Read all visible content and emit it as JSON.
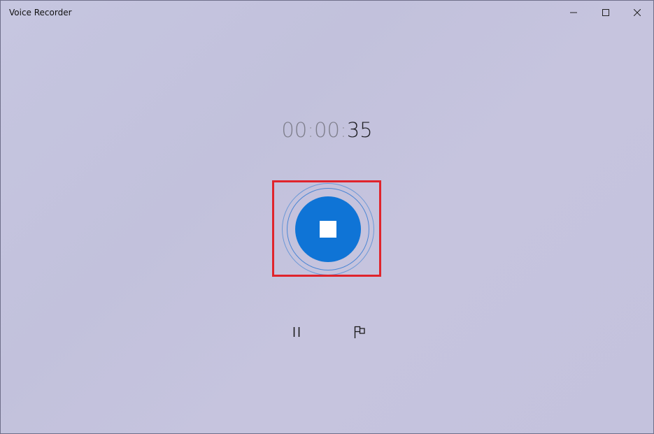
{
  "window": {
    "title": "Voice Recorder"
  },
  "timer": {
    "hours": "00",
    "minutes": "00",
    "seconds": "35",
    "separator": ":"
  },
  "controls": {
    "stop_icon": "stop-square-icon",
    "pause_icon": "pause-icon",
    "marker_icon": "flag-icon"
  },
  "colors": {
    "accent": "#0f74d6",
    "ring": "#4d86d4",
    "highlight": "#e0242c",
    "background": "#c4c3de"
  }
}
